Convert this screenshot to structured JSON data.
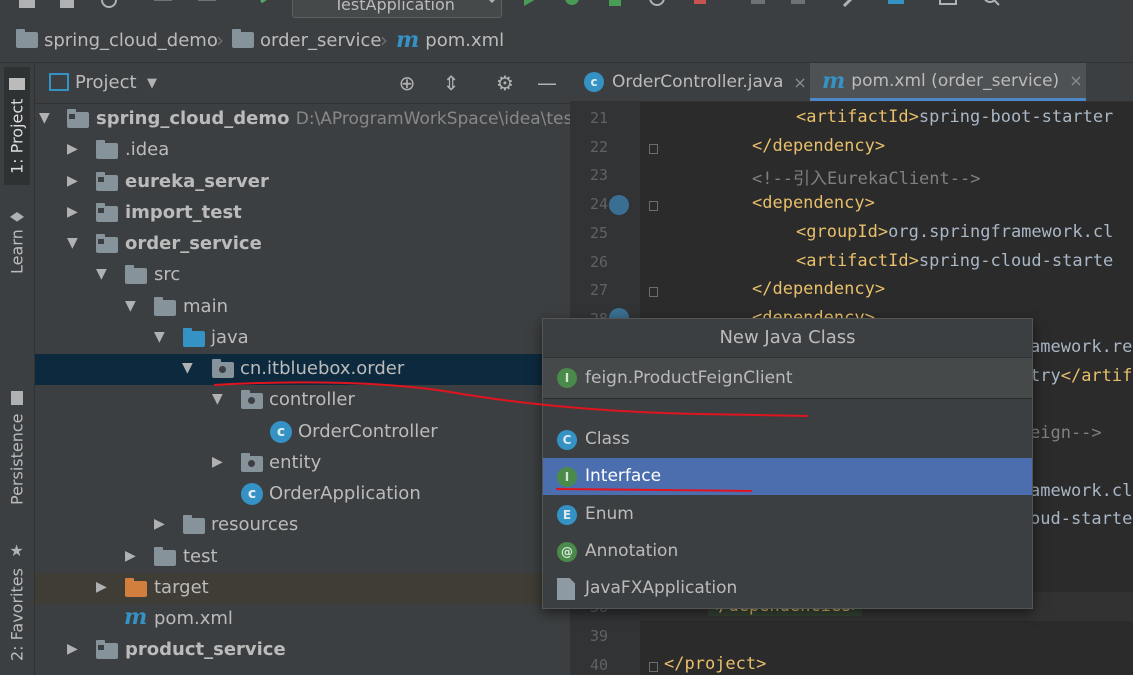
{
  "toolbar": {
    "run_config": "TestApplication"
  },
  "breadcrumb": [
    {
      "label": "spring_cloud_demo",
      "icon": "folder-icon"
    },
    {
      "label": "order_service",
      "icon": "folder-icon"
    },
    {
      "label": "pom.xml",
      "icon": "maven-icon"
    }
  ],
  "left_strip": {
    "project_tab": "1: Project",
    "learn_tab": "Learn",
    "persistence_tab": "Persistence",
    "favorites_tab": "2: Favorites"
  },
  "project_panel": {
    "title": "Project",
    "tree": [
      {
        "label": "spring_cloud_demo",
        "path": "D:\\AProgramWorkSpace\\idea\\test\\sp"
      },
      {
        "label": ".idea"
      },
      {
        "label": "eureka_server"
      },
      {
        "label": "import_test"
      },
      {
        "label": "order_service"
      },
      {
        "label": "src"
      },
      {
        "label": "main"
      },
      {
        "label": "java"
      },
      {
        "label": "cn.itbluebox.order"
      },
      {
        "label": "controller"
      },
      {
        "label": "OrderController"
      },
      {
        "label": "entity"
      },
      {
        "label": "OrderApplication"
      },
      {
        "label": "resources"
      },
      {
        "label": "test"
      },
      {
        "label": "target"
      },
      {
        "label": "pom.xml"
      },
      {
        "label": "product_service"
      }
    ]
  },
  "editor": {
    "tabs": [
      {
        "label": "OrderController.java",
        "close": "×"
      },
      {
        "label": "pom.xml (order_service)",
        "close": "×"
      }
    ],
    "lines": [
      {
        "n": "21"
      },
      {
        "n": "22"
      },
      {
        "n": "23"
      },
      {
        "n": "24"
      },
      {
        "n": "25"
      },
      {
        "n": "26"
      },
      {
        "n": "27"
      },
      {
        "n": "28"
      },
      {
        "n": "38"
      },
      {
        "n": "39"
      },
      {
        "n": "40"
      }
    ],
    "code": {
      "l21_open": "<artifactId>",
      "l21_text": "spring-boot-starter",
      "l22": "</dependency>",
      "l23": "<!--引入EurekaClient-->",
      "l24": "<dependency>",
      "l25_open": "<groupId>",
      "l25_text": "org.springframework.cl",
      "l26_open": "<artifactId>",
      "l26_text": "spring-cloud-starte",
      "l27": "</dependency>",
      "l28": "<dependency>",
      "r_a": "amework.re",
      "r_b_text": "try",
      "r_b_tag": "</artif",
      "r_c": "eign-->",
      "r_d": "amework.cl",
      "r_e": "oud-starte",
      "l38": "</dependencies>",
      "l40": "</project>"
    }
  },
  "popup": {
    "title": "New Java Class",
    "input_value": "feign.ProductFeignClient",
    "items": [
      {
        "label": "Class",
        "letter": "C"
      },
      {
        "label": "Interface",
        "letter": "I"
      },
      {
        "label": "Enum",
        "letter": "E"
      },
      {
        "label": "Annotation",
        "letter": "@"
      },
      {
        "label": "JavaFXApplication",
        "letter": "J"
      }
    ],
    "selected": "Interface"
  },
  "colors": {
    "selection": "#4b6eaf",
    "tree_selection": "#0d293e",
    "annotation_red": "#e0141e",
    "xml_tag": "#e8bf6a"
  }
}
